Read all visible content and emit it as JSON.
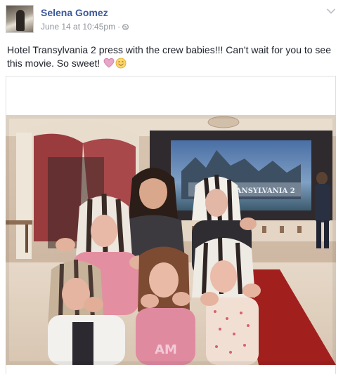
{
  "post": {
    "author": "Selena Gomez",
    "timestamp": "June 14 at 10:45pm",
    "separator": "·",
    "message": "Hotel Transylvania 2 press with the crew babies!!! Can't wait for you to see this movie. So sweet!",
    "emojis": [
      "heart-icon",
      "smiling-face-icon"
    ],
    "visibility_icon": "globe-icon",
    "menu_icon": "chevron-down-icon"
  },
  "photo": {
    "screen_title": "HOTEL TRANSYLVANIA 2"
  },
  "colors": {
    "author_link": "#3b5998",
    "meta_text": "#90949c",
    "body_text": "#1d2129",
    "border": "#dddfe2"
  }
}
